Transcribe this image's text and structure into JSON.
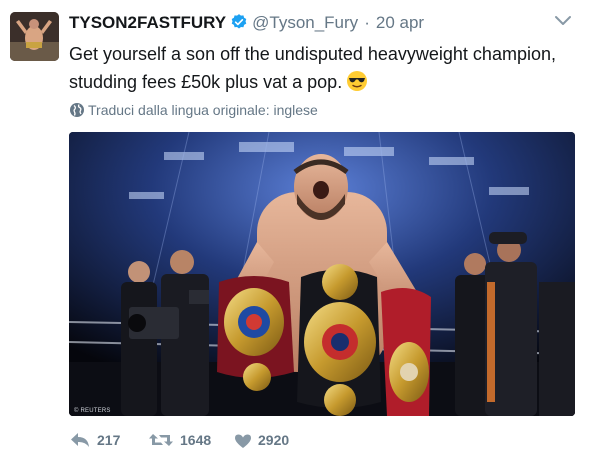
{
  "user": {
    "display_name": "TYSON2FASTFURY",
    "handle": "@Tyson_Fury",
    "separator": "·",
    "date": "20 apr"
  },
  "tweet": {
    "text": "Get yourself a son off the undisputed heavyweight champion, studding fees £50k plus vat a pop.",
    "emoji": "sunglasses-emoji"
  },
  "translate": {
    "label": "Traduci dalla lingua originale: inglese"
  },
  "media": {
    "credit": "© REUTERS"
  },
  "actions": {
    "reply_count": "217",
    "retweet_count": "1648",
    "like_count": "2920"
  },
  "colors": {
    "verified": "#1da1f2",
    "secondary_text": "#657786",
    "primary_text": "#14171a"
  },
  "icons": [
    "verified-badge-icon",
    "chevron-down-icon",
    "globe-icon",
    "reply-icon",
    "retweet-icon",
    "heart-icon"
  ]
}
